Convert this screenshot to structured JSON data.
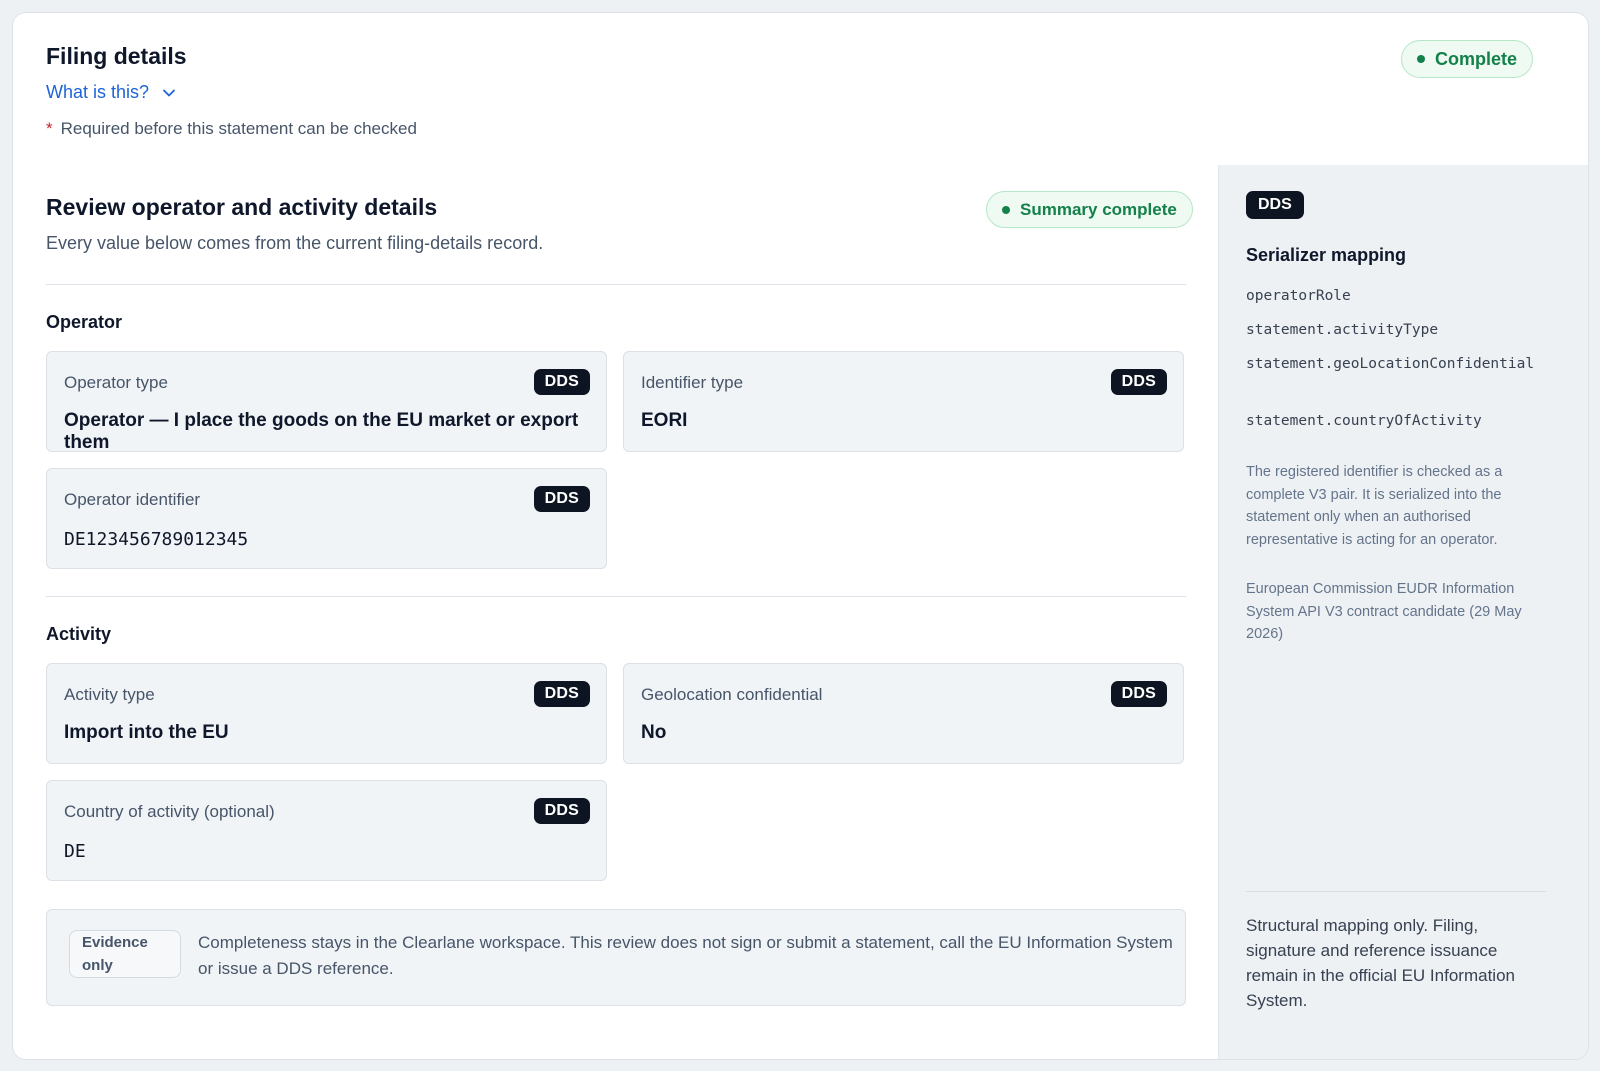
{
  "header": {
    "title": "Filing details",
    "what_is_this": "What is this?",
    "required_marker": "*",
    "required_note": "Required before this statement can be checked",
    "status": "Complete"
  },
  "review": {
    "title": "Review operator and activity details",
    "subtitle": "Every value below comes from the current filing-details record.",
    "status": "Summary complete"
  },
  "operator": {
    "section_title": "Operator",
    "fields": [
      {
        "label": "Operator type",
        "value": "Operator — I place the goods on the EU market or export them",
        "tag": "DDS"
      },
      {
        "label": "Identifier type",
        "value": "EORI",
        "tag": "DDS"
      },
      {
        "label": "Operator identifier",
        "value": "DE123456789012345",
        "tag": "DDS"
      }
    ]
  },
  "activity": {
    "section_title": "Activity",
    "fields": [
      {
        "label": "Activity type",
        "value": "Import into the EU",
        "tag": "DDS"
      },
      {
        "label": "Geolocation confidential",
        "value": "No",
        "tag": "DDS"
      },
      {
        "label": "Country of activity (optional)",
        "value": "DE",
        "tag": "DDS"
      }
    ]
  },
  "evidence": {
    "badge": "Evidence only",
    "text": "Completeness stays in the Clearlane workspace. This review does not sign or submit a statement, call the EU Information System or issue a DDS reference."
  },
  "sidebar": {
    "tag": "DDS",
    "title": "Serializer mapping",
    "mappings": [
      "operatorRole",
      "statement.activityType",
      "statement.geoLocationConfidential",
      "statement.countryOfActivity"
    ],
    "note": "The registered identifier is checked as a complete V3 pair. It is serialized into the statement only when an authorised representative is acting for an operator.",
    "source": "European Commission EUDR Information System API V3 contract candidate (29 May 2026)",
    "footer": "Structural mapping only. Filing, signature and reference issuance remain in the official EU Information System."
  },
  "colors": {
    "accent_link": "#1d64d8",
    "success": "#14804a",
    "tag_bg": "#0d1522",
    "required": "#c4262e"
  }
}
